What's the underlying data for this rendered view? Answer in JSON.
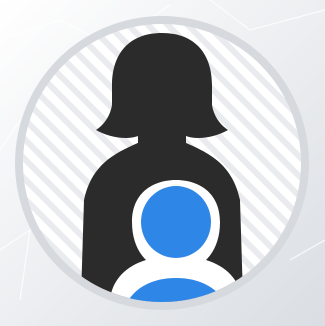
{
  "icon": {
    "name": "mother-child-icon",
    "colors": {
      "background_light": "#ffffff",
      "background_shade": "#dadee3",
      "circle_border": "#d6d9de",
      "circle_fill": "#ffffff",
      "stripes": "#e9ebee",
      "parent_figure": "#2b2b2b",
      "child_figure": "#2e86e6",
      "child_outline": "#ffffff"
    }
  }
}
